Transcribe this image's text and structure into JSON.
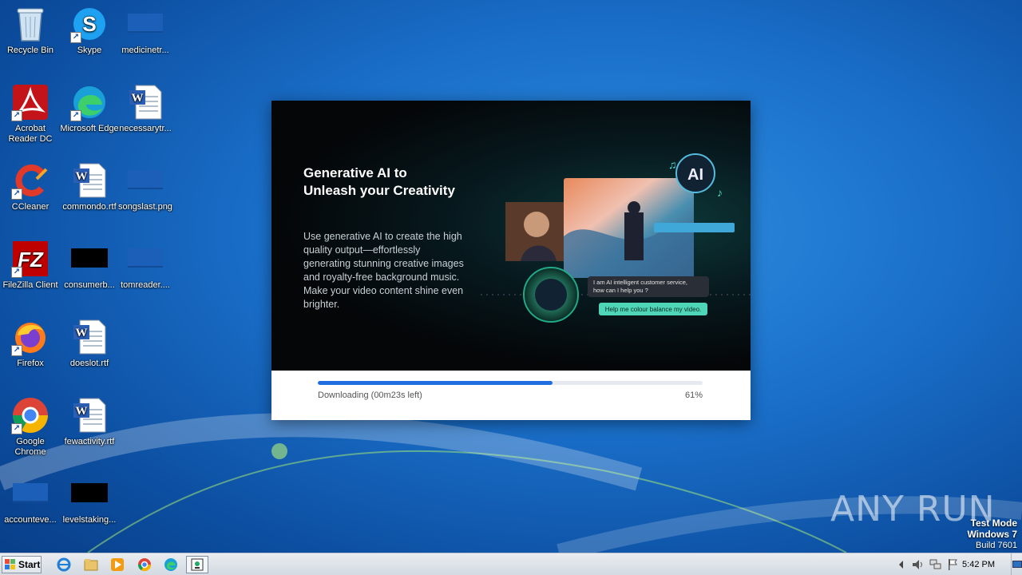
{
  "desktop": {
    "icons": [
      {
        "label": "Recycle Bin",
        "icon": "recycle-bin-icon"
      },
      {
        "label": "Skype",
        "icon": "skype-icon"
      },
      {
        "label": "medicinetr...",
        "icon": "blank-file-icon"
      },
      {
        "label": "Acrobat Reader DC",
        "icon": "acrobat-icon"
      },
      {
        "label": "Microsoft Edge",
        "icon": "edge-icon"
      },
      {
        "label": "necessarytr...",
        "icon": "word-doc-icon"
      },
      {
        "label": "CCleaner",
        "icon": "ccleaner-icon"
      },
      {
        "label": "commondo.rtf",
        "icon": "word-doc-icon"
      },
      {
        "label": "songslast.png",
        "icon": "blank-file-icon"
      },
      {
        "label": "FileZilla Client",
        "icon": "filezilla-icon"
      },
      {
        "label": "consumerb...",
        "icon": "black-thumbnail-icon"
      },
      {
        "label": "tomreader....",
        "icon": "blank-file-icon"
      },
      {
        "label": "Firefox",
        "icon": "firefox-icon"
      },
      {
        "label": "doeslot.rtf",
        "icon": "word-doc-icon"
      },
      {
        "label": "Google Chrome",
        "icon": "chrome-icon"
      },
      {
        "label": "fewactivity.rtf",
        "icon": "word-doc-icon"
      },
      {
        "label": "accounteve...",
        "icon": "blank-file-icon"
      },
      {
        "label": "levelstaking...",
        "icon": "black-thumbnail-icon"
      }
    ]
  },
  "installer": {
    "headline": "Generative AI to Unleash your Creativity",
    "body": "Use generative AI to create the high quality output—effortlessly generating stunning creative images and royalty-free background music. Make your video content shine even brighter.",
    "art": {
      "ai_badge": "AI",
      "chat_bot": "I am AI intelligent customer service, how can I help you ?",
      "chat_user": "Help me colour balance my video."
    },
    "progress": {
      "status": "Downloading (00m23s left)",
      "percent_label": "61%",
      "fraction": 0.61
    }
  },
  "watermark": "ANY RUN",
  "system": {
    "test_mode": "Test Mode",
    "os": "Windows 7",
    "build": "Build 7601"
  },
  "taskbar": {
    "start_label": "Start",
    "pinned": [
      "ie-icon",
      "explorer-icon",
      "media-player-icon",
      "chrome-icon",
      "edge-icon",
      "installer-app-icon"
    ],
    "clock": "5:42 PM"
  },
  "colors": {
    "progress_fill": "#1f6fe0",
    "chat_user_bg": "#4fd6b8"
  }
}
